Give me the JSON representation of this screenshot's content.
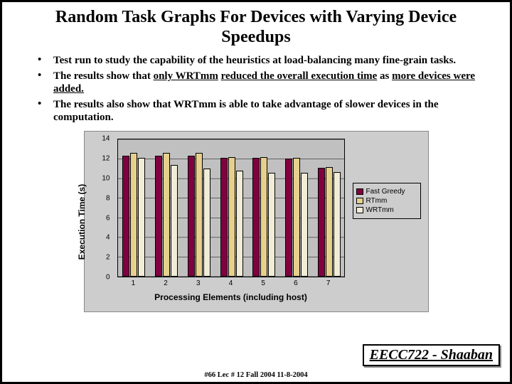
{
  "title": "Random Task Graphs For Devices with Varying Device Speedups",
  "bullets": [
    {
      "pre": "Test run to study  the capability of the heuristics at load-balancing many fine-grain tasks.",
      "u1": "",
      "mid": "",
      "u2": "",
      "post": ""
    },
    {
      "pre": "The results show that ",
      "u1": "only WRTmm",
      "mid": " ",
      "u2": "reduced the overall execution time",
      "post": " as ",
      "u3": "more devices were added.",
      "tail": ""
    },
    {
      "pre": "The results also show that WRTmm is able to take advantage of slower devices in the computation.",
      "u1": "",
      "mid": "",
      "u2": "",
      "post": ""
    }
  ],
  "chart_data": {
    "type": "bar",
    "title": "",
    "xlabel": "Processing Elements (including host)",
    "ylabel": "Execution Time (s)",
    "ylim": [
      0,
      14
    ],
    "yticks": [
      0,
      2,
      4,
      6,
      8,
      10,
      12,
      14
    ],
    "categories": [
      "1",
      "2",
      "3",
      "4",
      "5",
      "6",
      "7"
    ],
    "series": [
      {
        "name": "Fast Greedy",
        "color": "#800040",
        "values": [
          12.2,
          12.2,
          12.2,
          12.0,
          12.0,
          11.9,
          11.0
        ]
      },
      {
        "name": "RTmm",
        "color": "#e6d08c",
        "values": [
          12.5,
          12.5,
          12.5,
          12.1,
          12.1,
          12.0,
          11.1
        ]
      },
      {
        "name": "WRTmm",
        "color": "#f0ecd6",
        "values": [
          12.0,
          11.3,
          10.9,
          10.7,
          10.5,
          10.5,
          10.6
        ]
      }
    ]
  },
  "footer": {
    "course": "EECC722 - Shaaban",
    "note": "#66   Lec # 12   Fall 2004  11-8-2004"
  }
}
